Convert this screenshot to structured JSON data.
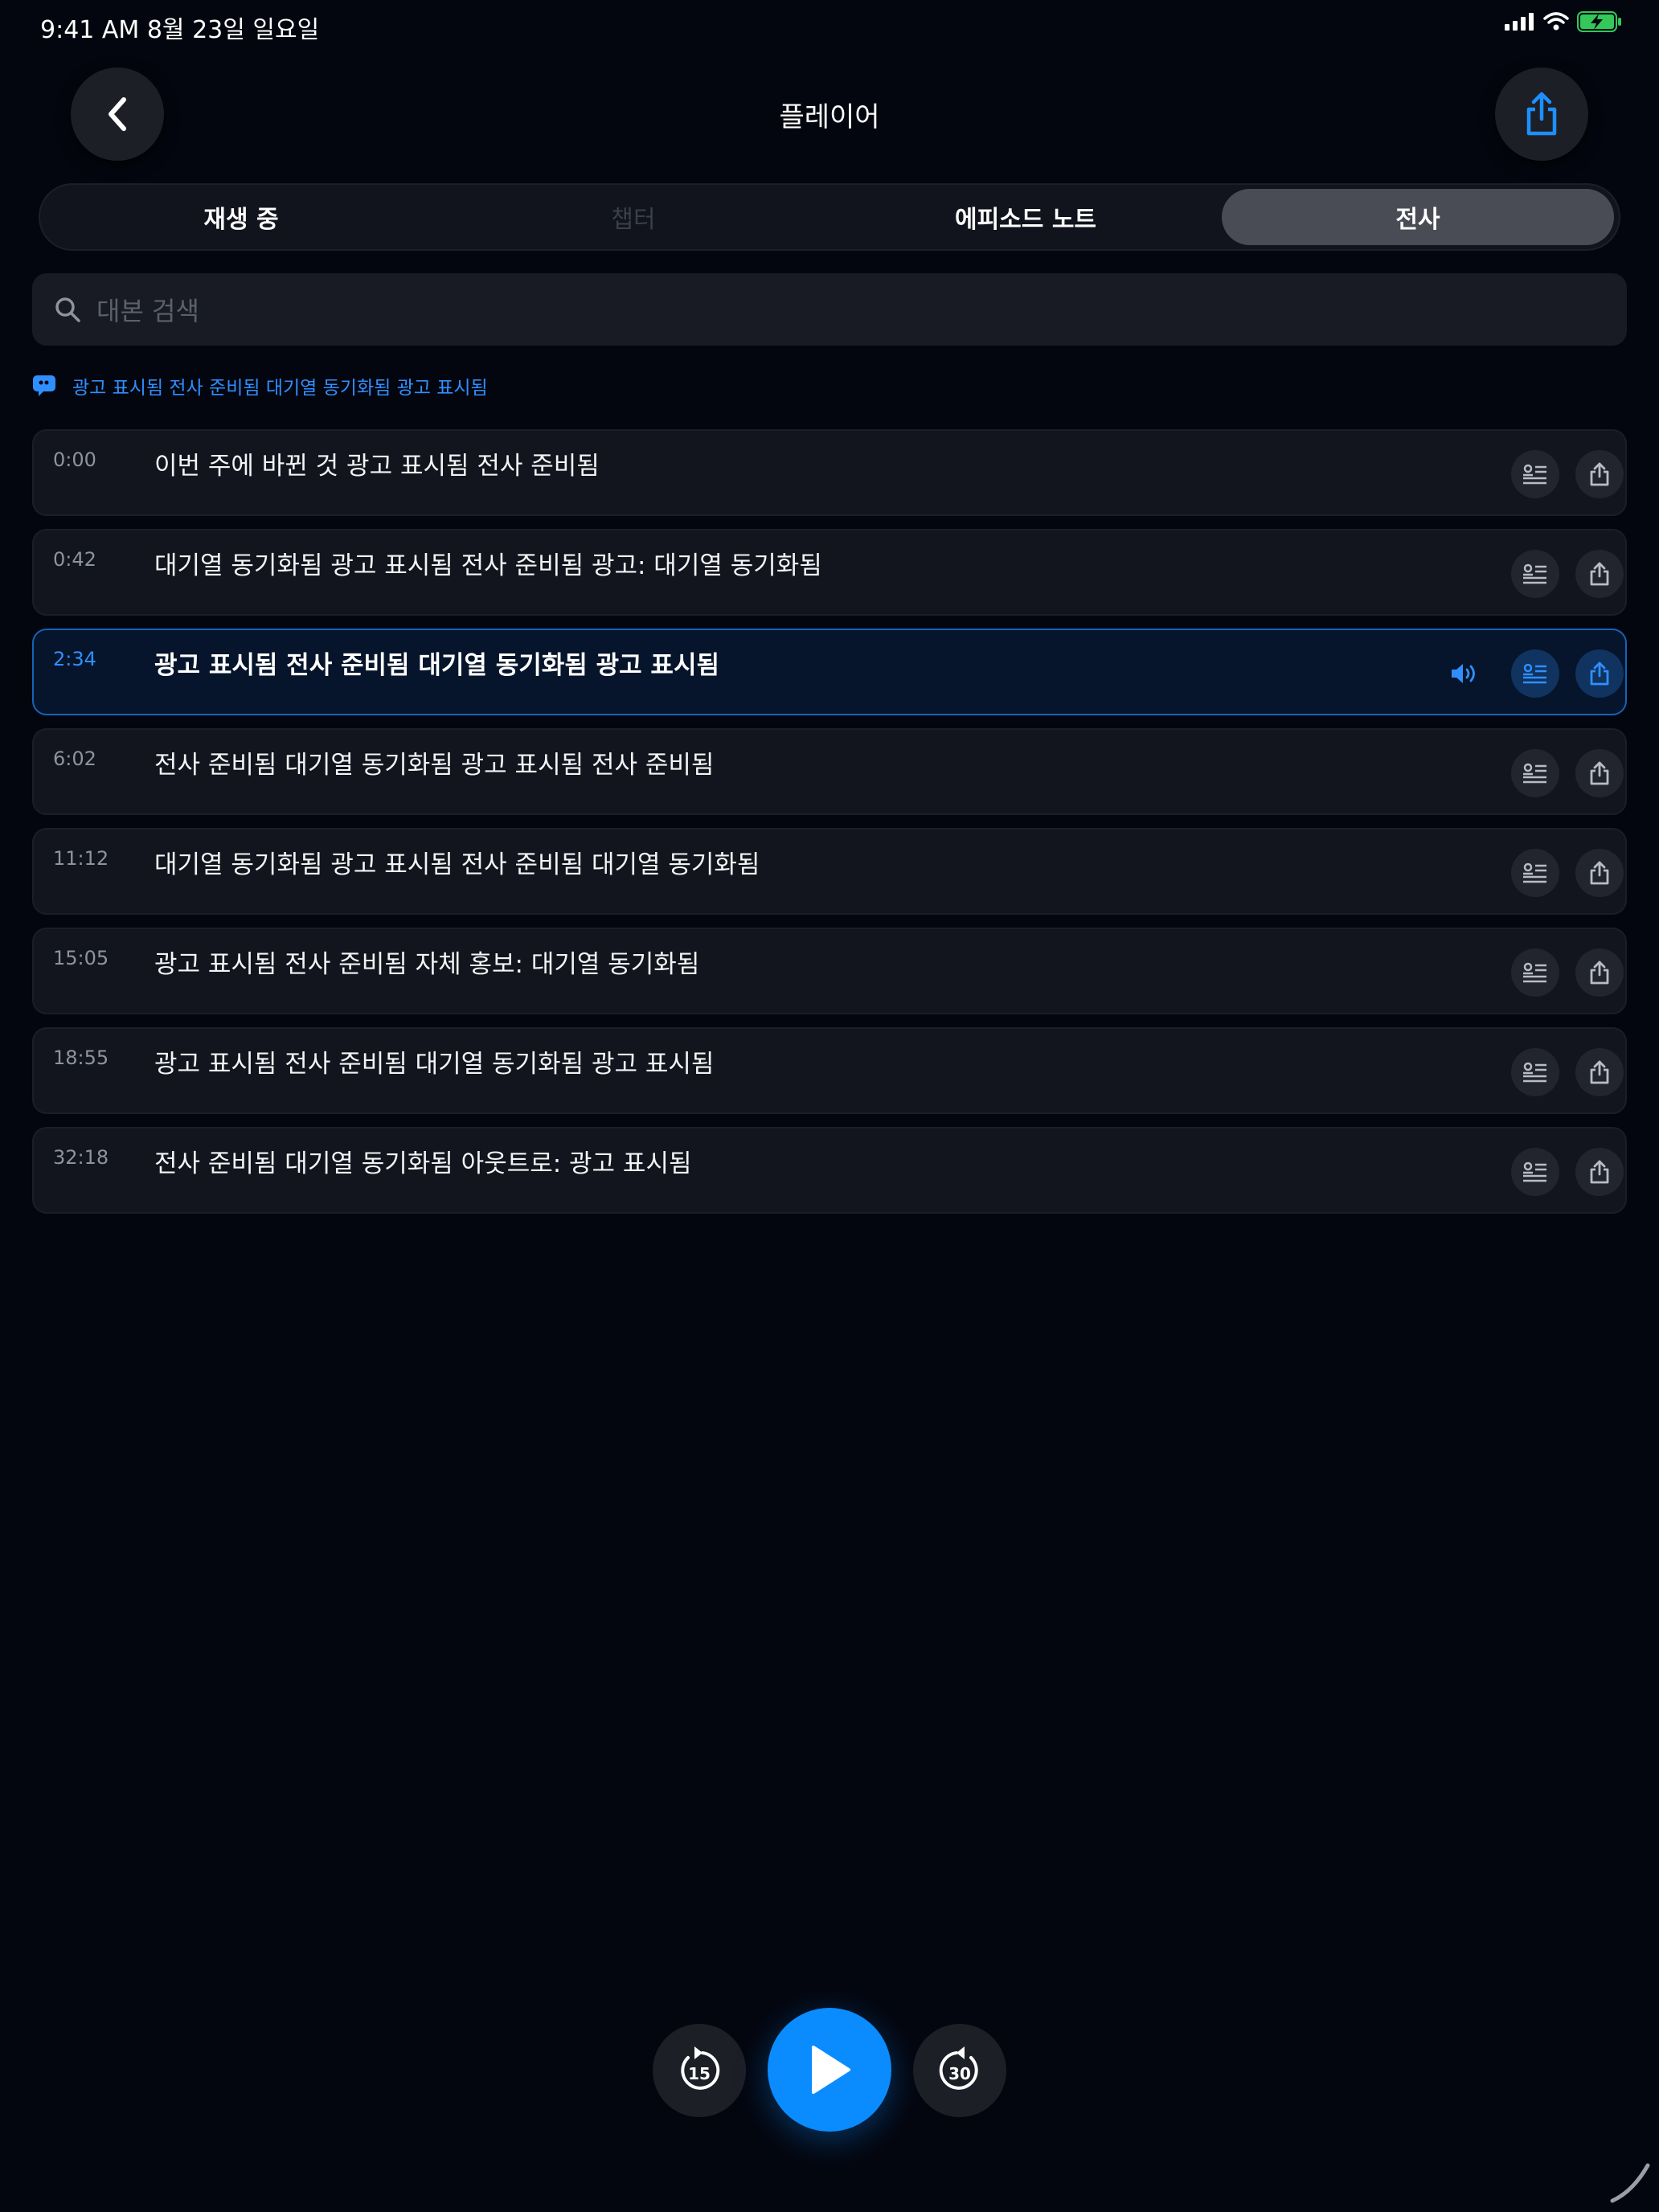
{
  "status_bar": {
    "time": "9:41 AM   8월 23일 일요일"
  },
  "header": {
    "title": "플레이어",
    "back_icon": "chevron-left-icon",
    "share_icon": "share-icon"
  },
  "tabs": [
    {
      "label": "재생 중",
      "state": "normal"
    },
    {
      "label": "챕터",
      "state": "disabled"
    },
    {
      "label": "에피소드 노트",
      "state": "normal"
    },
    {
      "label": "전사",
      "state": "active"
    }
  ],
  "search": {
    "placeholder": "대본 검색"
  },
  "banner": {
    "text": "광고 표시됨 전사 준비됨 대기열 동기화됨 광고 표시됨"
  },
  "transcript": [
    {
      "time": "0:00",
      "text": "이번 주에 바뀐 것 광고 표시됨 전사 준비됨"
    },
    {
      "time": "0:42",
      "text": "대기열 동기화됨 광고 표시됨 전사 준비됨 광고: 대기열 동기화됨"
    },
    {
      "time": "2:34",
      "text": "광고 표시됨 전사 준비됨 대기열 동기화됨 광고 표시됨",
      "active": true
    },
    {
      "time": "6:02",
      "text": "전사 준비됨 대기열 동기화됨 광고 표시됨 전사 준비됨"
    },
    {
      "time": "11:12",
      "text": "대기열 동기화됨 광고 표시됨 전사 준비됨 대기열 동기화됨"
    },
    {
      "time": "15:05",
      "text": "광고 표시됨 전사 준비됨 자체 홍보: 대기열 동기화됨"
    },
    {
      "time": "18:55",
      "text": "광고 표시됨 전사 준비됨 대기열 동기화됨 광고 표시됨"
    },
    {
      "time": "32:18",
      "text": "전사 준비됨 대기열 동기화됨 아웃트로: 광고 표시됨"
    }
  ],
  "controls": {
    "skip_back": "15",
    "skip_forward": "30"
  },
  "colors": {
    "accent": "#0a8cff",
    "background": "#04060f"
  }
}
